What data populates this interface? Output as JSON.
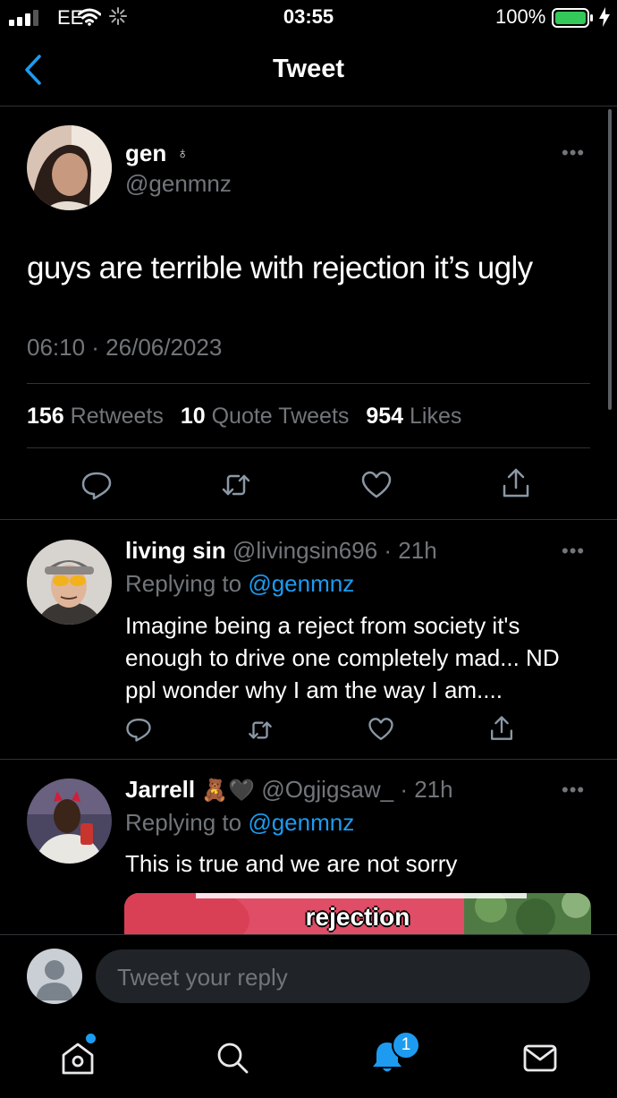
{
  "status_bar": {
    "carrier": "EE",
    "time": "03:55",
    "battery": "100%"
  },
  "nav": {
    "title": "Tweet"
  },
  "tweet": {
    "name": "gen",
    "name_symbol": "♁",
    "handle": "@genmnz",
    "text": "guys are terrible with rejection it’s ugly",
    "timestamp": "06:10 · 26/06/2023",
    "retweets_count": "156",
    "retweets_label": "Retweets",
    "quotes_count": "10",
    "quotes_label": "Quote Tweets",
    "likes_count": "954",
    "likes_label": "Likes"
  },
  "replies": [
    {
      "name": "living sin",
      "handle": "@livingsin696",
      "time": "· 21h",
      "replying_label": "Replying to",
      "replying_to": "@genmnz",
      "text": "Imagine being a reject from society it's enough to drive one completely mad... ND ppl wonder why I am the way I am...."
    },
    {
      "name": "Jarrell",
      "emoji": "🧸🖤",
      "handle": "@Ogjigsaw_",
      "time": "· 21h",
      "replying_label": "Replying to",
      "replying_to": "@genmnz",
      "text": "This is true and we are not sorry",
      "media_caption": "rejection"
    }
  ],
  "reply_box": {
    "placeholder": "Tweet your reply"
  },
  "tabbar": {
    "notifications_badge": "1"
  },
  "colors": {
    "accent": "#1d9bf0",
    "background": "#000000",
    "muted": "#71767b",
    "battery": "#34c759"
  }
}
